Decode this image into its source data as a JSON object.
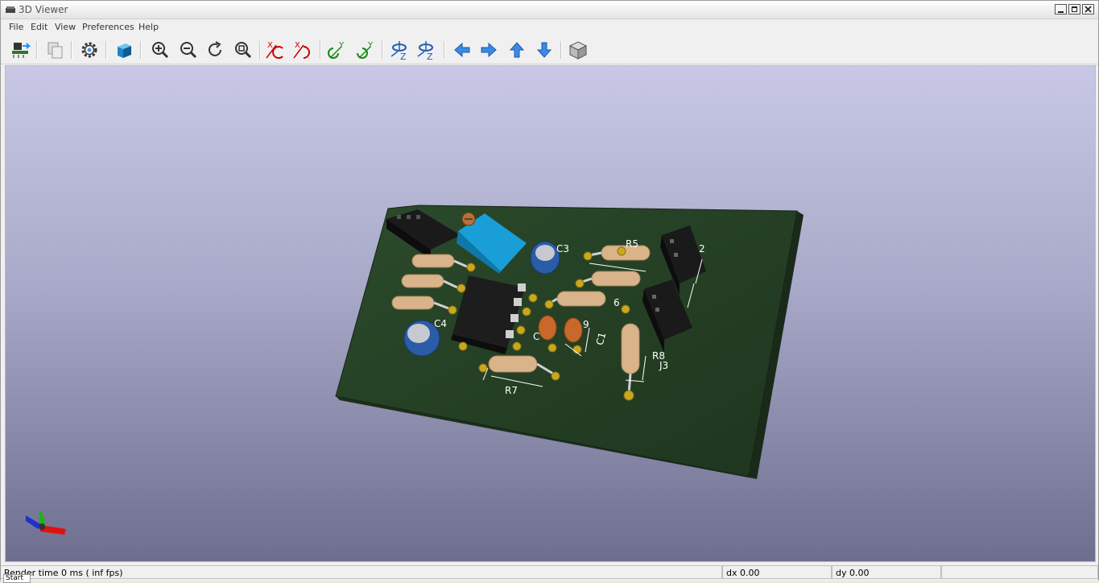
{
  "window": {
    "title": "3D Viewer"
  },
  "menu": {
    "items": [
      {
        "label": "File"
      },
      {
        "label": "Edit"
      },
      {
        "label": "View"
      },
      {
        "label": "Preferences"
      },
      {
        "label": "Help"
      }
    ]
  },
  "toolbar": {
    "buttons": [
      {
        "icon": "reload-board-icon"
      },
      {
        "icon": "copy-image-icon"
      },
      {
        "icon": "settings-gear-icon"
      },
      {
        "icon": "raytracing-cube-icon"
      },
      {
        "icon": "zoom-in-icon"
      },
      {
        "icon": "zoom-out-icon"
      },
      {
        "icon": "redraw-icon"
      },
      {
        "icon": "zoom-fit-icon"
      },
      {
        "icon": "rotate-x-cw-icon"
      },
      {
        "icon": "rotate-x-ccw-icon"
      },
      {
        "icon": "rotate-y-cw-icon"
      },
      {
        "icon": "rotate-y-ccw-icon"
      },
      {
        "icon": "rotate-z-cw-icon"
      },
      {
        "icon": "rotate-z-ccw-icon"
      },
      {
        "icon": "move-left-icon"
      },
      {
        "icon": "move-right-icon"
      },
      {
        "icon": "move-up-icon"
      },
      {
        "icon": "move-down-icon"
      },
      {
        "icon": "ortho-view-cube-icon"
      }
    ]
  },
  "board": {
    "labels": {
      "c3": "C3",
      "r5": "R5",
      "j2": "2",
      "c4": "C4",
      "r6": "6",
      "c9": "9",
      "c1": "C1",
      "c": "C",
      "r8": "R8",
      "j3": "J3",
      "r7": "R7"
    }
  },
  "status": {
    "render": "Render time 0 ms ( inf fps)",
    "dx": "dx 0.00",
    "dy": "dy 0.00",
    "start": "Start"
  }
}
